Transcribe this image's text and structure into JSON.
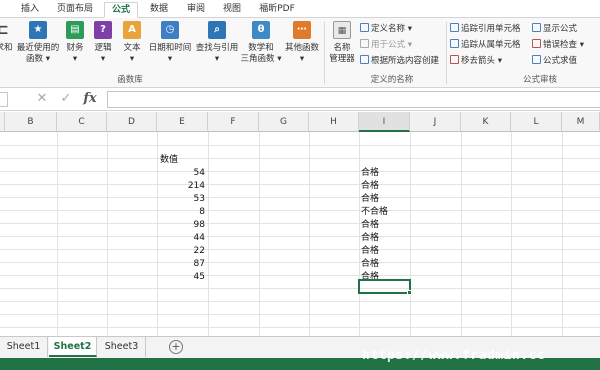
{
  "ribbon_tabs": [
    {
      "label": "插入",
      "active": false
    },
    {
      "label": "页面布局",
      "active": false
    },
    {
      "label": "公式",
      "active": true
    },
    {
      "label": "数据",
      "active": false
    },
    {
      "label": "审阅",
      "active": false
    },
    {
      "label": "视图",
      "active": false
    },
    {
      "label": "福昕PDF",
      "active": false
    }
  ],
  "ribbon": {
    "function_library": {
      "items": [
        {
          "label": "求和",
          "icon": "autosum-icon",
          "color": "#444444"
        },
        {
          "label": "最近使用的\n函数 ▾",
          "icon": "star-icon",
          "color": "#2e75b6"
        },
        {
          "label": "财务\n▾",
          "icon": "finance-icon",
          "color": "#2e9b58"
        },
        {
          "label": "逻辑\n▾",
          "icon": "question-icon",
          "color": "#7e3fa8"
        },
        {
          "label": "文本\n▾",
          "icon": "text-icon",
          "color": "#e8a33a"
        },
        {
          "label": "日期和时间\n▾",
          "icon": "clock-icon",
          "color": "#3e7ec5"
        },
        {
          "label": "查找与引用\n▾",
          "icon": "lookup-icon",
          "color": "#2e75b6"
        },
        {
          "label": "数学和\n三角函数 ▾",
          "icon": "theta-icon",
          "color": "#3d8ac4"
        },
        {
          "label": "其他函数\n▾",
          "icon": "more-functions-icon",
          "color": "#e07b2b"
        }
      ],
      "group_label": "函数库"
    },
    "defined_names": {
      "name_manager": "名称\n管理器",
      "define_name": "定义名称 ▾",
      "use_in_formula": "用于公式 ▾",
      "create_from_selection": "根据所选内容创建",
      "group_label": "定义的名称"
    },
    "formula_auditing": {
      "trace_precedents": "追踪引用单元格",
      "trace_dependents": "追踪从属单元格",
      "remove_arrows": "移去箭头 ▾",
      "show_formulas": "显示公式",
      "error_checking": "错误检查 ▾",
      "evaluate_formula": "公式求值",
      "group_label": "公式审核"
    }
  },
  "formula_bar": {
    "cancel": "✕",
    "enter": "✓",
    "fx": "fx",
    "value": ""
  },
  "grid": {
    "columns": [
      "B",
      "C",
      "D",
      "E",
      "F",
      "G",
      "H",
      "I",
      "J",
      "K",
      "L",
      "M"
    ],
    "selected_column": "I",
    "header_cell": "数值",
    "values": [
      "54",
      "214",
      "53",
      "8",
      "98",
      "44",
      "22",
      "87",
      "45"
    ],
    "results": [
      "合格",
      "合格",
      "合格",
      "不合格",
      "合格",
      "合格",
      "合格",
      "合格",
      "合格"
    ]
  },
  "sheets": [
    {
      "label": "Sheet1",
      "active": false
    },
    {
      "label": "Sheet2",
      "active": true
    },
    {
      "label": "Sheet3",
      "active": false
    }
  ],
  "add_sheet": "+",
  "watermark": "https://www.fradmin.cc",
  "colors": {
    "accent": "#217346"
  }
}
